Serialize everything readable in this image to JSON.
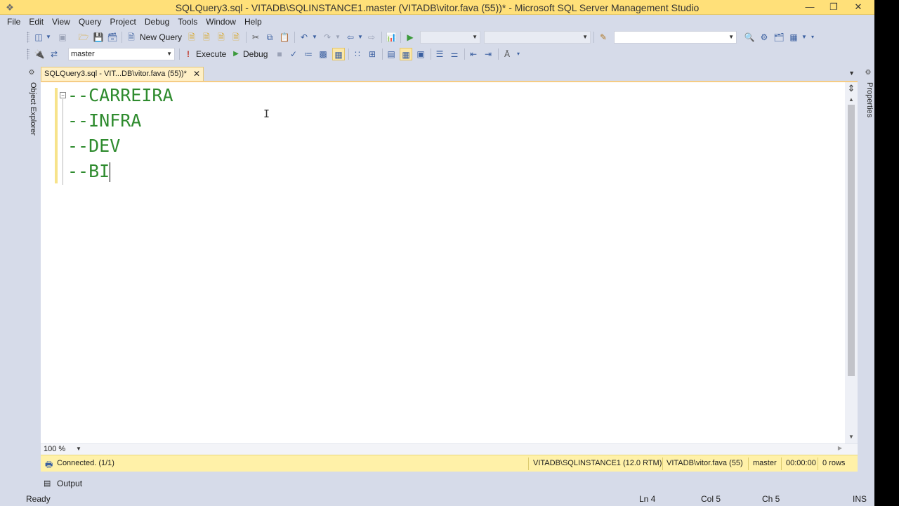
{
  "window": {
    "title": "SQLQuery3.sql - VITADB\\SQLINSTANCE1.master (VITADB\\vitor.fava (55))* - Microsoft SQL Server Management Studio",
    "minimize": "—",
    "restore": "❐",
    "close": "✕"
  },
  "menu": [
    "File",
    "Edit",
    "View",
    "Query",
    "Project",
    "Debug",
    "Tools",
    "Window",
    "Help"
  ],
  "toolbar1": {
    "new_query_label": "New Query"
  },
  "toolbar2": {
    "database_selected": "master",
    "execute_label": "Execute",
    "debug_label": "Debug"
  },
  "side_panels": {
    "left": "Object Explorer",
    "right": "Properties"
  },
  "document": {
    "tab_label": "SQLQuery3.sql - VIT...DB\\vitor.fava (55))*",
    "code_lines": [
      "--CARREIRA",
      "--INFRA",
      "--DEV",
      "--BI"
    ]
  },
  "zoom": "100 %",
  "query_status": {
    "connection": "Connected. (1/1)",
    "server": "VITADB\\SQLINSTANCE1 (12.0 RTM)",
    "user": "VITADB\\vitor.fava (55)",
    "database": "master",
    "elapsed": "00:00:00",
    "rows": "0 rows"
  },
  "output_tab": "Output",
  "statusbar": {
    "state": "Ready",
    "line": "Ln 4",
    "column": "Col 5",
    "char": "Ch 5",
    "mode": "INS"
  },
  "colors": {
    "titlebar": "#ffe079",
    "chrome": "#d6dbe9",
    "comment_text": "#2e8b2e",
    "query_status_bar": "#fff1a8"
  }
}
